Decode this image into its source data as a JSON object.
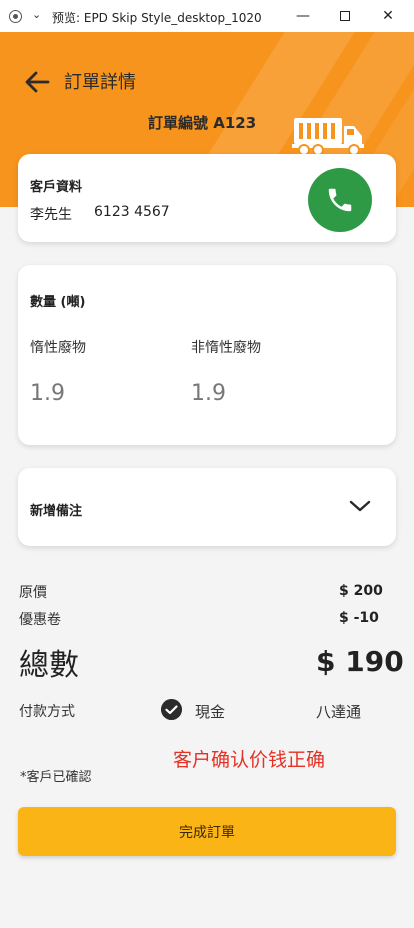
{
  "window": {
    "title": "预览: EPD Skip Style_desktop_1020",
    "minimize_glyph": "—",
    "close_glyph": "✕"
  },
  "header": {
    "page_title": "訂單詳情",
    "order_number": "訂單編號 A123",
    "accent_color": "#f7941d"
  },
  "customer": {
    "section_title": "客戶資料",
    "name": "李先生",
    "phone": "6123 4567",
    "call_button_color": "#2e9a46"
  },
  "quantity": {
    "section_title": "數量 (噸)",
    "inert_label": "惰性廢物",
    "inert_value": "1.9",
    "non_inert_label": "非惰性廢物",
    "non_inert_value": "1.9"
  },
  "notes": {
    "section_title": "新增備注"
  },
  "pricing": {
    "original_label": "原價",
    "original_value": "$  200",
    "coupon_label": "優惠卷",
    "coupon_value": "$  -10",
    "total_label": "總數",
    "total_value": "$ 190"
  },
  "payment": {
    "label": "付款方式",
    "cash_label": "現金",
    "octopus_label": "八達通",
    "selected": "現金"
  },
  "confirmation": {
    "text": "*客戶已確認",
    "annotation": "客户确认价钱正确",
    "annotation_color": "#e53125"
  },
  "actions": {
    "complete_label": "完成訂單",
    "complete_color": "#fbb416"
  }
}
